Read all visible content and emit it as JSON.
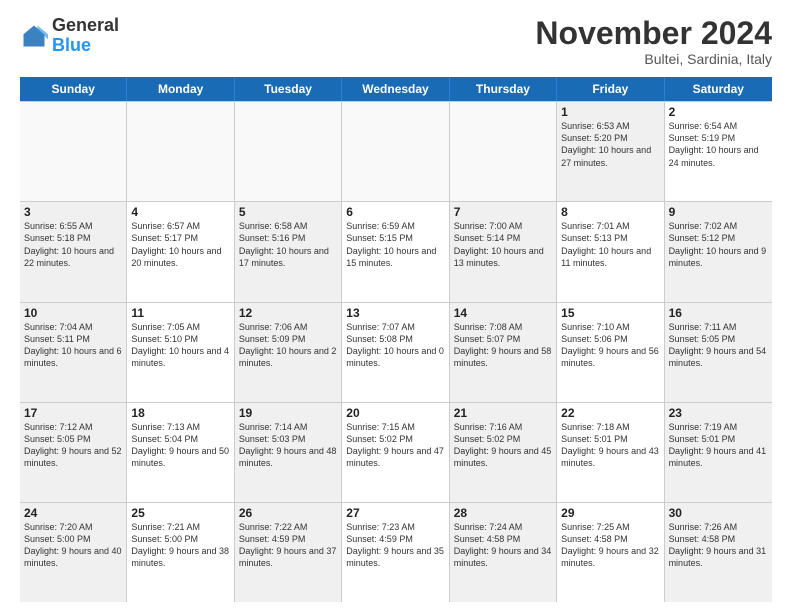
{
  "header": {
    "logo_general": "General",
    "logo_blue": "Blue",
    "month_title": "November 2024",
    "subtitle": "Bultei, Sardinia, Italy"
  },
  "days_of_week": [
    "Sunday",
    "Monday",
    "Tuesday",
    "Wednesday",
    "Thursday",
    "Friday",
    "Saturday"
  ],
  "rows": [
    [
      {
        "day": "",
        "info": "",
        "empty": true
      },
      {
        "day": "",
        "info": "",
        "empty": true
      },
      {
        "day": "",
        "info": "",
        "empty": true
      },
      {
        "day": "",
        "info": "",
        "empty": true
      },
      {
        "day": "",
        "info": "",
        "empty": true
      },
      {
        "day": "1",
        "info": "Sunrise: 6:53 AM\nSunset: 5:20 PM\nDaylight: 10 hours and 27 minutes.",
        "empty": false,
        "shaded": true
      },
      {
        "day": "2",
        "info": "Sunrise: 6:54 AM\nSunset: 5:19 PM\nDaylight: 10 hours and 24 minutes.",
        "empty": false,
        "shaded": false
      }
    ],
    [
      {
        "day": "3",
        "info": "Sunrise: 6:55 AM\nSunset: 5:18 PM\nDaylight: 10 hours and 22 minutes.",
        "empty": false,
        "shaded": true
      },
      {
        "day": "4",
        "info": "Sunrise: 6:57 AM\nSunset: 5:17 PM\nDaylight: 10 hours and 20 minutes.",
        "empty": false,
        "shaded": false
      },
      {
        "day": "5",
        "info": "Sunrise: 6:58 AM\nSunset: 5:16 PM\nDaylight: 10 hours and 17 minutes.",
        "empty": false,
        "shaded": true
      },
      {
        "day": "6",
        "info": "Sunrise: 6:59 AM\nSunset: 5:15 PM\nDaylight: 10 hours and 15 minutes.",
        "empty": false,
        "shaded": false
      },
      {
        "day": "7",
        "info": "Sunrise: 7:00 AM\nSunset: 5:14 PM\nDaylight: 10 hours and 13 minutes.",
        "empty": false,
        "shaded": true
      },
      {
        "day": "8",
        "info": "Sunrise: 7:01 AM\nSunset: 5:13 PM\nDaylight: 10 hours and 11 minutes.",
        "empty": false,
        "shaded": false
      },
      {
        "day": "9",
        "info": "Sunrise: 7:02 AM\nSunset: 5:12 PM\nDaylight: 10 hours and 9 minutes.",
        "empty": false,
        "shaded": true
      }
    ],
    [
      {
        "day": "10",
        "info": "Sunrise: 7:04 AM\nSunset: 5:11 PM\nDaylight: 10 hours and 6 minutes.",
        "empty": false,
        "shaded": true
      },
      {
        "day": "11",
        "info": "Sunrise: 7:05 AM\nSunset: 5:10 PM\nDaylight: 10 hours and 4 minutes.",
        "empty": false,
        "shaded": false
      },
      {
        "day": "12",
        "info": "Sunrise: 7:06 AM\nSunset: 5:09 PM\nDaylight: 10 hours and 2 minutes.",
        "empty": false,
        "shaded": true
      },
      {
        "day": "13",
        "info": "Sunrise: 7:07 AM\nSunset: 5:08 PM\nDaylight: 10 hours and 0 minutes.",
        "empty": false,
        "shaded": false
      },
      {
        "day": "14",
        "info": "Sunrise: 7:08 AM\nSunset: 5:07 PM\nDaylight: 9 hours and 58 minutes.",
        "empty": false,
        "shaded": true
      },
      {
        "day": "15",
        "info": "Sunrise: 7:10 AM\nSunset: 5:06 PM\nDaylight: 9 hours and 56 minutes.",
        "empty": false,
        "shaded": false
      },
      {
        "day": "16",
        "info": "Sunrise: 7:11 AM\nSunset: 5:05 PM\nDaylight: 9 hours and 54 minutes.",
        "empty": false,
        "shaded": true
      }
    ],
    [
      {
        "day": "17",
        "info": "Sunrise: 7:12 AM\nSunset: 5:05 PM\nDaylight: 9 hours and 52 minutes.",
        "empty": false,
        "shaded": true
      },
      {
        "day": "18",
        "info": "Sunrise: 7:13 AM\nSunset: 5:04 PM\nDaylight: 9 hours and 50 minutes.",
        "empty": false,
        "shaded": false
      },
      {
        "day": "19",
        "info": "Sunrise: 7:14 AM\nSunset: 5:03 PM\nDaylight: 9 hours and 48 minutes.",
        "empty": false,
        "shaded": true
      },
      {
        "day": "20",
        "info": "Sunrise: 7:15 AM\nSunset: 5:02 PM\nDaylight: 9 hours and 47 minutes.",
        "empty": false,
        "shaded": false
      },
      {
        "day": "21",
        "info": "Sunrise: 7:16 AM\nSunset: 5:02 PM\nDaylight: 9 hours and 45 minutes.",
        "empty": false,
        "shaded": true
      },
      {
        "day": "22",
        "info": "Sunrise: 7:18 AM\nSunset: 5:01 PM\nDaylight: 9 hours and 43 minutes.",
        "empty": false,
        "shaded": false
      },
      {
        "day": "23",
        "info": "Sunrise: 7:19 AM\nSunset: 5:01 PM\nDaylight: 9 hours and 41 minutes.",
        "empty": false,
        "shaded": true
      }
    ],
    [
      {
        "day": "24",
        "info": "Sunrise: 7:20 AM\nSunset: 5:00 PM\nDaylight: 9 hours and 40 minutes.",
        "empty": false,
        "shaded": true
      },
      {
        "day": "25",
        "info": "Sunrise: 7:21 AM\nSunset: 5:00 PM\nDaylight: 9 hours and 38 minutes.",
        "empty": false,
        "shaded": false
      },
      {
        "day": "26",
        "info": "Sunrise: 7:22 AM\nSunset: 4:59 PM\nDaylight: 9 hours and 37 minutes.",
        "empty": false,
        "shaded": true
      },
      {
        "day": "27",
        "info": "Sunrise: 7:23 AM\nSunset: 4:59 PM\nDaylight: 9 hours and 35 minutes.",
        "empty": false,
        "shaded": false
      },
      {
        "day": "28",
        "info": "Sunrise: 7:24 AM\nSunset: 4:58 PM\nDaylight: 9 hours and 34 minutes.",
        "empty": false,
        "shaded": true
      },
      {
        "day": "29",
        "info": "Sunrise: 7:25 AM\nSunset: 4:58 PM\nDaylight: 9 hours and 32 minutes.",
        "empty": false,
        "shaded": false
      },
      {
        "day": "30",
        "info": "Sunrise: 7:26 AM\nSunset: 4:58 PM\nDaylight: 9 hours and 31 minutes.",
        "empty": false,
        "shaded": true
      }
    ]
  ]
}
